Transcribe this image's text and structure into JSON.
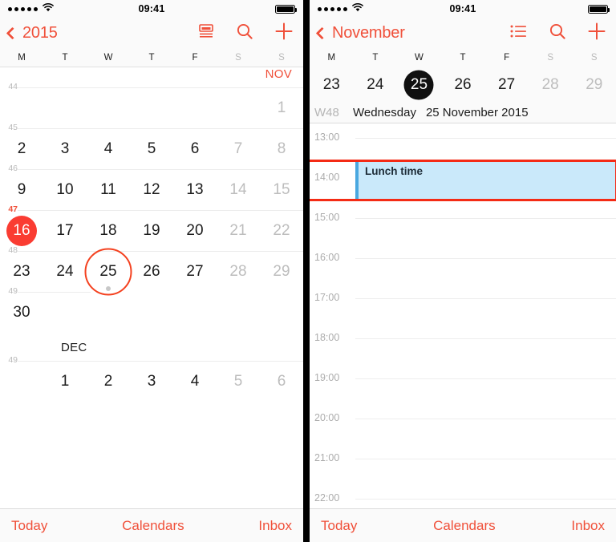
{
  "meta": {
    "accent_red": "#f0503a",
    "today_red": "#fa3c32",
    "annotation_red": "#f42b15",
    "event_fill": "#cae9fa",
    "event_bar": "#4aa8e0",
    "selected_black": "#101010"
  },
  "status_bar": {
    "time": "09:41",
    "signal_dots": 5,
    "wifi_icon": "wifi-icon",
    "battery_icon": "battery-full-icon",
    "battery_level": 100
  },
  "left_panel": {
    "nav": {
      "back_label": "2015",
      "back_icon": "chevron-left-icon",
      "actions": [
        {
          "name": "day-view-icon",
          "label": "Day view"
        },
        {
          "name": "search-icon",
          "label": "Search"
        },
        {
          "name": "add-icon",
          "label": "Add event"
        }
      ]
    },
    "weekdays": [
      {
        "label": "M",
        "weekend": false
      },
      {
        "label": "T",
        "weekend": false
      },
      {
        "label": "W",
        "weekend": false
      },
      {
        "label": "T",
        "weekend": false
      },
      {
        "label": "F",
        "weekend": false
      },
      {
        "label": "S",
        "weekend": true
      },
      {
        "label": "S",
        "weekend": true
      }
    ],
    "month_labels": [
      {
        "text": "NOV",
        "current": true
      },
      {
        "text": "DEC",
        "current": false
      }
    ],
    "weeks": [
      {
        "week_number": "44",
        "week_number_highlight": false,
        "days": [
          {
            "label": "",
            "blank": true
          },
          {
            "label": "",
            "blank": true
          },
          {
            "label": "",
            "blank": true
          },
          {
            "label": "",
            "blank": true
          },
          {
            "label": "",
            "blank": true
          },
          {
            "label": "",
            "blank": true
          },
          {
            "label": "1",
            "dim": true
          }
        ]
      },
      {
        "week_number": "45",
        "week_number_highlight": false,
        "days": [
          {
            "label": "2"
          },
          {
            "label": "3"
          },
          {
            "label": "4"
          },
          {
            "label": "5"
          },
          {
            "label": "6"
          },
          {
            "label": "7",
            "dim": true
          },
          {
            "label": "8",
            "dim": true
          }
        ]
      },
      {
        "week_number": "46",
        "week_number_highlight": false,
        "days": [
          {
            "label": "9"
          },
          {
            "label": "10"
          },
          {
            "label": "11"
          },
          {
            "label": "12"
          },
          {
            "label": "13"
          },
          {
            "label": "14",
            "dim": true
          },
          {
            "label": "15",
            "dim": true
          }
        ]
      },
      {
        "week_number": "47",
        "week_number_highlight": true,
        "days": [
          {
            "label": "16",
            "today": true
          },
          {
            "label": "17"
          },
          {
            "label": "18"
          },
          {
            "label": "19"
          },
          {
            "label": "20"
          },
          {
            "label": "21",
            "dim": true
          },
          {
            "label": "22",
            "dim": true
          }
        ]
      },
      {
        "week_number": "48",
        "week_number_highlight": false,
        "days": [
          {
            "label": "23"
          },
          {
            "label": "24"
          },
          {
            "label": "25",
            "selected": true,
            "has_event": true
          },
          {
            "label": "26"
          },
          {
            "label": "27"
          },
          {
            "label": "28",
            "dim": true
          },
          {
            "label": "29",
            "dim": true
          }
        ]
      },
      {
        "week_number": "49",
        "week_number_highlight": false,
        "days": [
          {
            "label": "30"
          },
          {
            "label": "",
            "blank": true
          },
          {
            "label": "",
            "blank": true
          },
          {
            "label": "",
            "blank": true
          },
          {
            "label": "",
            "blank": true
          },
          {
            "label": "",
            "blank": true
          },
          {
            "label": "",
            "blank": true
          }
        ]
      },
      {
        "week_number": "49",
        "week_number_highlight": false,
        "days": [
          {
            "label": "",
            "blank": true
          },
          {
            "label": "1"
          },
          {
            "label": "2"
          },
          {
            "label": "3"
          },
          {
            "label": "4"
          },
          {
            "label": "5",
            "dim": true
          },
          {
            "label": "6",
            "dim": true
          }
        ]
      }
    ],
    "toolbar": {
      "today": "Today",
      "calendars": "Calendars",
      "inbox": "Inbox"
    }
  },
  "right_panel": {
    "nav": {
      "back_label": "November",
      "back_icon": "chevron-left-icon",
      "actions": [
        {
          "name": "list-view-icon",
          "label": "List view"
        },
        {
          "name": "search-icon",
          "label": "Search"
        },
        {
          "name": "add-icon",
          "label": "Add event"
        }
      ]
    },
    "weekdays": [
      {
        "label": "M",
        "weekend": false
      },
      {
        "label": "T",
        "weekend": false
      },
      {
        "label": "W",
        "weekend": false
      },
      {
        "label": "T",
        "weekend": false
      },
      {
        "label": "F",
        "weekend": false
      },
      {
        "label": "S",
        "weekend": true
      },
      {
        "label": "S",
        "weekend": true
      }
    ],
    "week_days": [
      {
        "label": "23"
      },
      {
        "label": "24"
      },
      {
        "label": "25",
        "selected": true
      },
      {
        "label": "26"
      },
      {
        "label": "27"
      },
      {
        "label": "28",
        "dim": true
      },
      {
        "label": "29",
        "dim": true
      }
    ],
    "day_info": {
      "week": "W48",
      "day_of_week": "Wednesday",
      "date": "25 November 2015"
    },
    "hours": [
      "13:00",
      "14:00",
      "15:00",
      "16:00",
      "17:00",
      "18:00",
      "19:00",
      "20:00",
      "21:00",
      "22:00"
    ],
    "events": [
      {
        "title": "Lunch time",
        "start_hour_index": 1,
        "duration_hours": 1,
        "highlighted": true
      }
    ],
    "toolbar": {
      "today": "Today",
      "calendars": "Calendars",
      "inbox": "Inbox"
    }
  }
}
